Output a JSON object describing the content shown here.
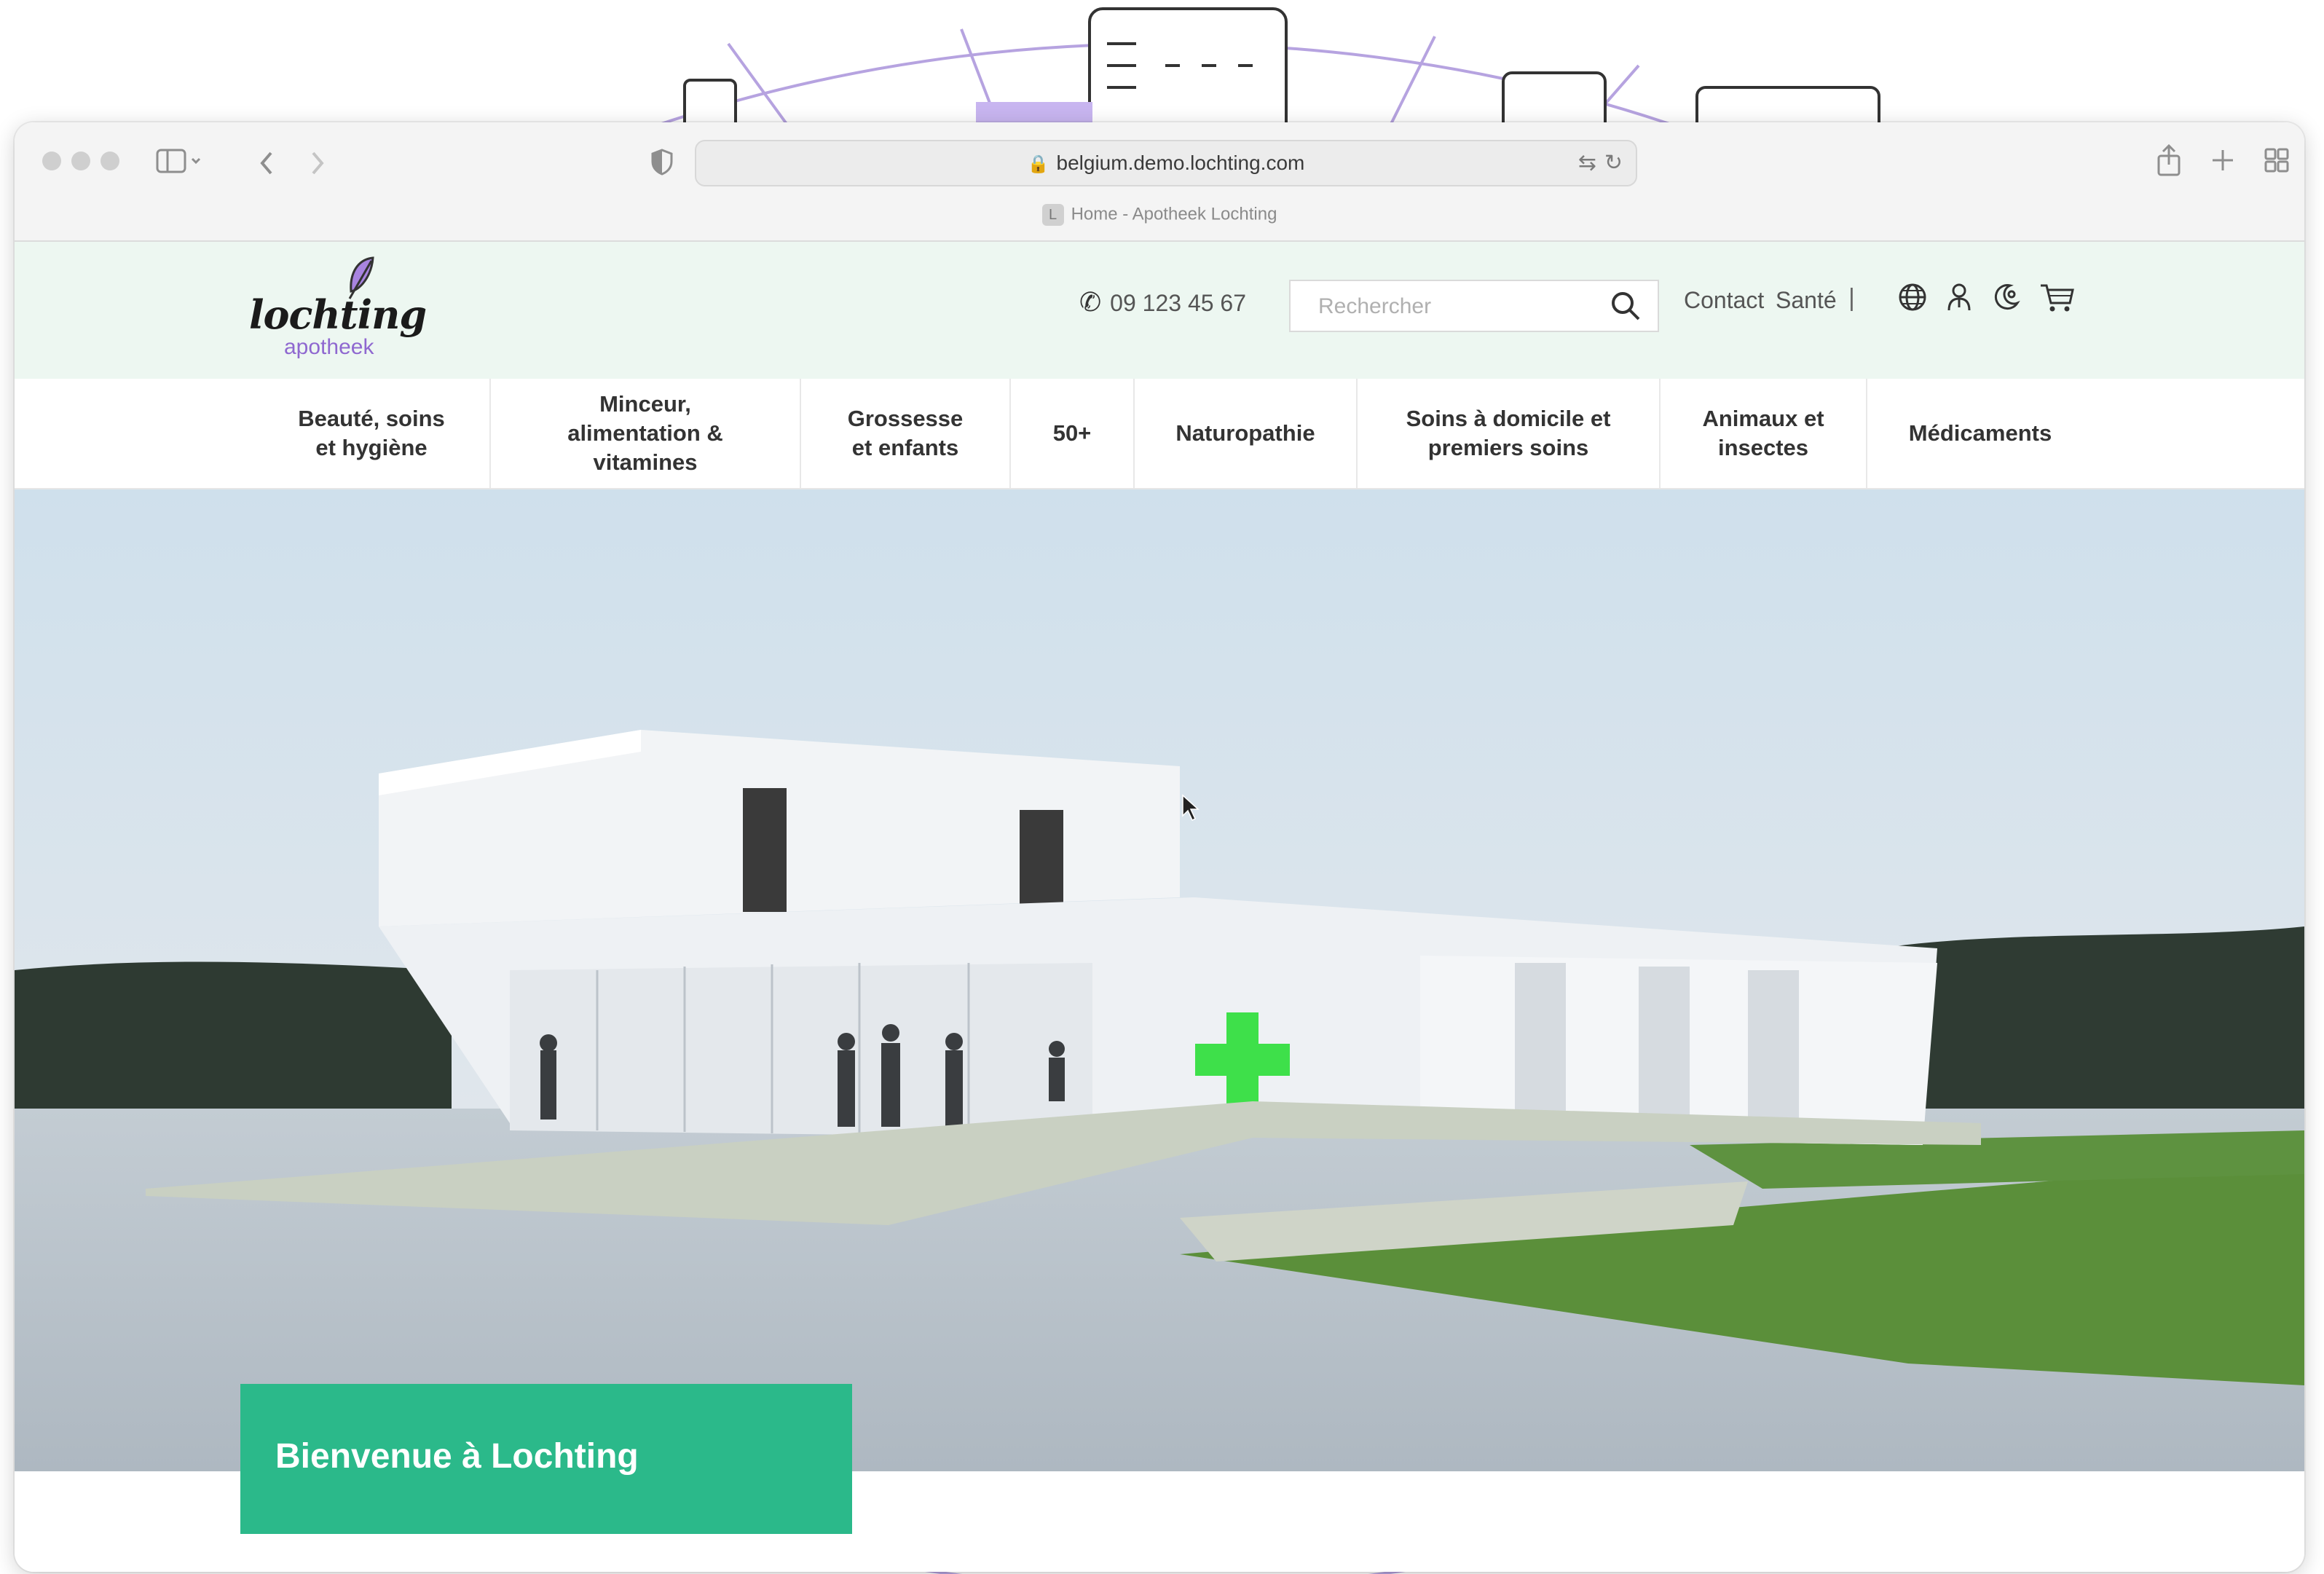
{
  "browser": {
    "url": "belgium.demo.lochting.com",
    "tab_title": "Home - Apotheek Lochting",
    "tab_favicon": "L"
  },
  "header": {
    "logo_name": "lochting",
    "logo_sub": "apotheek",
    "phone": "09 123 45 67",
    "search_placeholder": "Rechercher",
    "links": [
      "Contact",
      "Santé"
    ],
    "separator": "|",
    "icons": [
      "globe-icon",
      "user-icon",
      "theme-icon",
      "cart-icon"
    ]
  },
  "nav": {
    "items": [
      "Beauté, soins et hygiène",
      "Minceur, alimentation & vitamines",
      "Grossesse et enfants",
      "50+",
      "Naturopathie",
      "Soins à domicile et premiers soins",
      "Animaux et insectes",
      "Médicaments"
    ]
  },
  "hero": {
    "welcome": "Bienvenue à Lochting"
  },
  "colors": {
    "header_bg": "#edf7f1",
    "accent_green": "#2bb98a",
    "logo_purple": "#8f68d0",
    "pharmacy_cross": "#3ee04a"
  }
}
